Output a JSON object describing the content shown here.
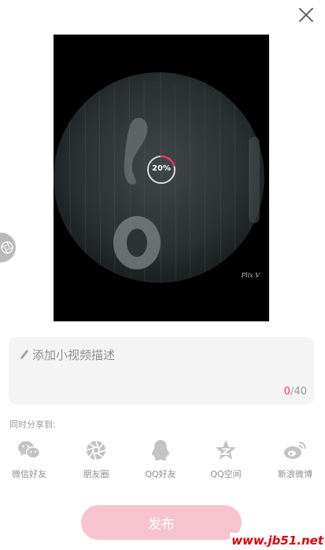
{
  "video": {
    "progress_percent": 20,
    "progress_label": "20%",
    "watermark": "Plix V",
    "accent_color": "#e8385e"
  },
  "description": {
    "placeholder": "添加小视频描述",
    "value": "",
    "count_current": "0",
    "count_max": "/40"
  },
  "share": {
    "label": "同时分享到:",
    "items": [
      {
        "label": "微信好友",
        "icon": "wechat-icon"
      },
      {
        "label": "朋友圈",
        "icon": "moments-icon"
      },
      {
        "label": "QQ好友",
        "icon": "qq-icon"
      },
      {
        "label": "QQ空间",
        "icon": "qzone-icon"
      },
      {
        "label": "新浪微博",
        "icon": "weibo-icon"
      }
    ]
  },
  "publish": {
    "label": "发布",
    "color": "#f6c3ce"
  },
  "site_stamp": "www.jb51.net"
}
